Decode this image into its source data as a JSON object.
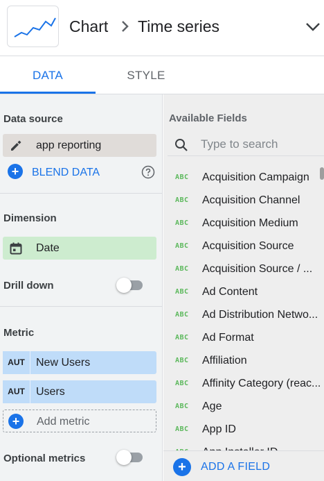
{
  "header": {
    "breadcrumb_root": "Chart",
    "breadcrumb_current": "Time series",
    "thumbnail_icon": "time-series-chart-icon",
    "collapse_icon": "chevron-down-icon"
  },
  "tabs": [
    {
      "label": "DATA",
      "active": true
    },
    {
      "label": "STYLE",
      "active": false
    }
  ],
  "data_source": {
    "label": "Data source",
    "value": "app reporting",
    "blend_label": "BLEND DATA"
  },
  "dimension": {
    "label": "Dimension",
    "value": "Date",
    "drill_down_label": "Drill down",
    "drill_down_on": false
  },
  "metric": {
    "label": "Metric",
    "items": [
      {
        "agg": "AUT",
        "name": "New Users"
      },
      {
        "agg": "AUT",
        "name": "Users"
      }
    ],
    "add_label": "Add metric",
    "optional_label": "Optional metrics",
    "optional_on": false
  },
  "available_fields": {
    "title": "Available Fields",
    "search_placeholder": "Type to search",
    "type_badge": "ABC",
    "items": [
      "Acquisition Campaign",
      "Acquisition Channel",
      "Acquisition Medium",
      "Acquisition Source",
      "Acquisition Source / ...",
      "Ad Content",
      "Ad Distribution Netwo...",
      "Ad Format",
      "Affiliation",
      "Affinity Category (reac...",
      "Age",
      "App ID",
      "App Installer ID"
    ],
    "add_field_label": "ADD A FIELD"
  },
  "colors": {
    "accent": "#1a73e8",
    "dimension_chip": "#cdeccf",
    "metric_chip": "#bfdcf9",
    "source_chip": "#e0dcd9",
    "text_type_badge": "#5cb85c"
  }
}
